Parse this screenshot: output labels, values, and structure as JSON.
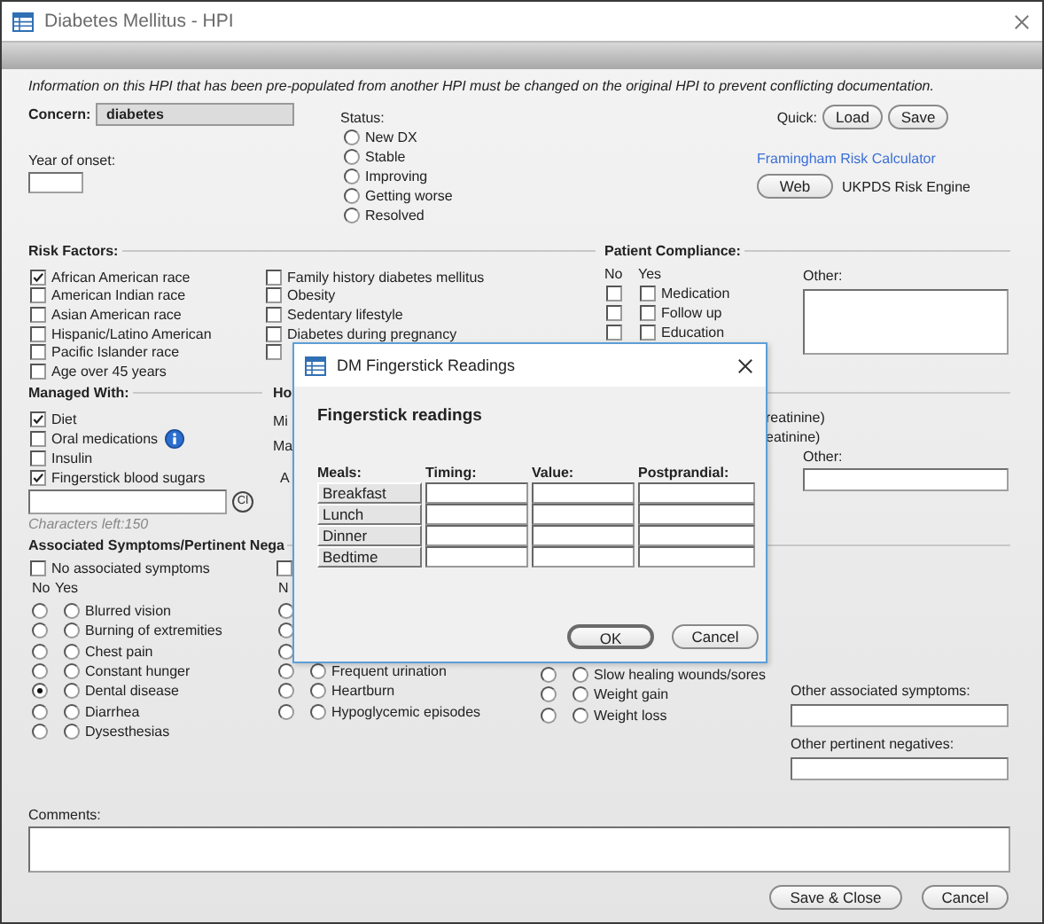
{
  "window": {
    "title": "Diabetes Mellitus - HPI"
  },
  "notice": "Information on this HPI that has been pre-populated from another HPI must be changed on the original HPI to prevent conflicting documentation.",
  "concern": {
    "label": "Concern:",
    "value": "diabetes"
  },
  "year_of_onset": {
    "label": "Year of onset:"
  },
  "status": {
    "label": "Status:",
    "options": [
      {
        "label": "New DX",
        "selected": false
      },
      {
        "label": "Stable",
        "selected": false
      },
      {
        "label": "Improving",
        "selected": false
      },
      {
        "label": "Getting worse",
        "selected": false
      },
      {
        "label": "Resolved",
        "selected": false
      }
    ]
  },
  "quick": {
    "label": "Quick:",
    "buttons": [
      "Load",
      "Save"
    ]
  },
  "framingham_link": "Framingham Risk Calculator",
  "ukpds": {
    "button": "Web",
    "label": "UKPDS Risk Engine"
  },
  "risk_factors": {
    "title": "Risk Factors:",
    "columns": [
      [
        {
          "label": "African American race",
          "checked": true
        },
        {
          "label": "American Indian race",
          "checked": false
        },
        {
          "label": "Asian American race",
          "checked": false
        },
        {
          "label": "Hispanic/Latino American",
          "checked": false
        },
        {
          "label": "Pacific Islander race",
          "checked": false
        },
        {
          "label": "Age over 45 years",
          "checked": false
        }
      ],
      [
        {
          "label": "Family history diabetes mellitus",
          "checked": false
        },
        {
          "label": "Obesity",
          "checked": false
        },
        {
          "label": "Sedentary lifestyle",
          "checked": false
        },
        {
          "label": "Diabetes during pregnancy",
          "checked": false
        },
        {
          "checked": false
        }
      ]
    ]
  },
  "patient_compliance": {
    "title": "Patient Compliance:",
    "no_header": "No",
    "yes_header": "Yes",
    "items": [
      {
        "label": "Medication",
        "no": false,
        "yes": false
      },
      {
        "label": "Follow up",
        "no": false,
        "yes": false
      },
      {
        "label": "Education",
        "no": false,
        "yes": false
      }
    ],
    "other_label": "Other:"
  },
  "managed_with": {
    "title": "Managed With:",
    "items": [
      {
        "label": "Diet",
        "checked": true,
        "info": false
      },
      {
        "label": "Oral medications",
        "checked": false,
        "info": true
      },
      {
        "label": "Insulin",
        "checked": false,
        "info": false
      },
      {
        "label": "Fingerstick blood sugars",
        "checked": true,
        "info": false
      }
    ],
    "clear_button": "Cl",
    "characters_left": "Characters left:150"
  },
  "how_section": {
    "title": "Ho",
    "lines": [
      "Mi",
      "Ma",
      "A"
    ],
    "right_lines": [
      "reatinine)",
      "eatinine)"
    ],
    "other_label": "Other:"
  },
  "associated": {
    "title": "Associated Symptoms/Pertinent Nega",
    "columns": [
      {
        "none": {
          "label": "No associated symptoms",
          "checked": false
        },
        "no_header": "No",
        "yes_header": "Yes",
        "items": [
          {
            "label": "Blurred vision",
            "no": false,
            "yes": false
          },
          {
            "label": "Burning of extremities",
            "no": false,
            "yes": false
          },
          {
            "label": "Chest pain",
            "no": false,
            "yes": false
          },
          {
            "label": "Constant hunger",
            "no": false,
            "yes": false
          },
          {
            "label": "Dental disease",
            "no": true,
            "yes": false
          },
          {
            "label": "Diarrhea",
            "no": false,
            "yes": false
          },
          {
            "label": "Dysesthesias",
            "no": false,
            "yes": false
          }
        ]
      },
      {
        "none": {
          "checked": false
        },
        "no_header": "N",
        "items": [
          {
            "no": false
          },
          {
            "no": false
          },
          {
            "no": false
          },
          {
            "label": "Frequent urination",
            "no": false,
            "yes": false
          },
          {
            "label": "Heartburn",
            "no": false,
            "yes": false
          },
          {
            "label": "Hypoglycemic episodes",
            "no": false,
            "yes": false
          }
        ]
      },
      {
        "items": [
          {
            "label": "Slow healing wounds/sores",
            "no": false,
            "yes": false
          },
          {
            "label": "Weight gain",
            "no": false,
            "yes": false
          },
          {
            "label": "Weight loss",
            "no": false,
            "yes": false
          }
        ]
      }
    ],
    "other_associated_label": "Other associated symptoms:",
    "other_negatives_label": "Other pertinent negatives:"
  },
  "comments": {
    "label": "Comments:"
  },
  "footer_buttons": [
    "Save & Close",
    "Cancel"
  ],
  "dialog": {
    "title": "DM Fingerstick Readings",
    "heading": "Fingerstick readings",
    "columns": [
      "Meals:",
      "Timing:",
      "Value:",
      "Postprandial:"
    ],
    "rows": [
      "Breakfast",
      "Lunch",
      "Dinner",
      "Bedtime"
    ],
    "buttons": [
      {
        "label": "OK",
        "default": true
      },
      {
        "label": "Cancel",
        "default": false
      }
    ]
  }
}
